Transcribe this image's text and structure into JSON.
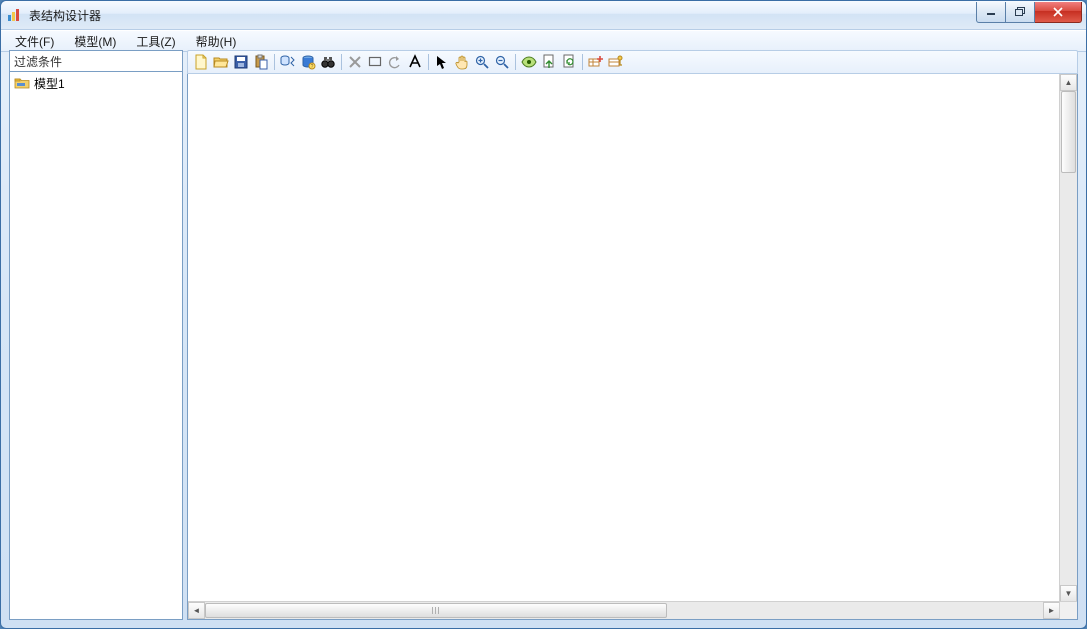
{
  "window": {
    "title": "表结构设计器"
  },
  "menubar": {
    "file": "文件(F)",
    "model": "模型(M)",
    "tools": "工具(Z)",
    "help": "帮助(H)"
  },
  "sidebar": {
    "filter_placeholder": "过滤条件",
    "items": [
      {
        "label": "模型1"
      }
    ]
  },
  "toolbar": {
    "icons": {
      "new": "new-file-icon",
      "open": "open-folder-icon",
      "save": "save-icon",
      "paste": "paste-icon",
      "db_import": "db-sync-icon",
      "db_help": "db-info-icon",
      "find": "binoculars-icon",
      "delete": "delete-icon",
      "rect": "rectangle-icon",
      "undo": "undo-icon",
      "text": "text-a-icon",
      "pointer": "pointer-icon",
      "pan": "hand-icon",
      "zoom_in": "zoom-in-icon",
      "zoom_out": "zoom-out-icon",
      "preview": "eye-icon",
      "export": "export-doc-icon",
      "refresh": "refresh-doc-icon",
      "add_field": "add-field-icon",
      "add_key": "add-key-icon"
    }
  },
  "colors": {
    "accent": "#d6e6f7",
    "border": "#7a9ec4",
    "close_red": "#d94b3f"
  }
}
